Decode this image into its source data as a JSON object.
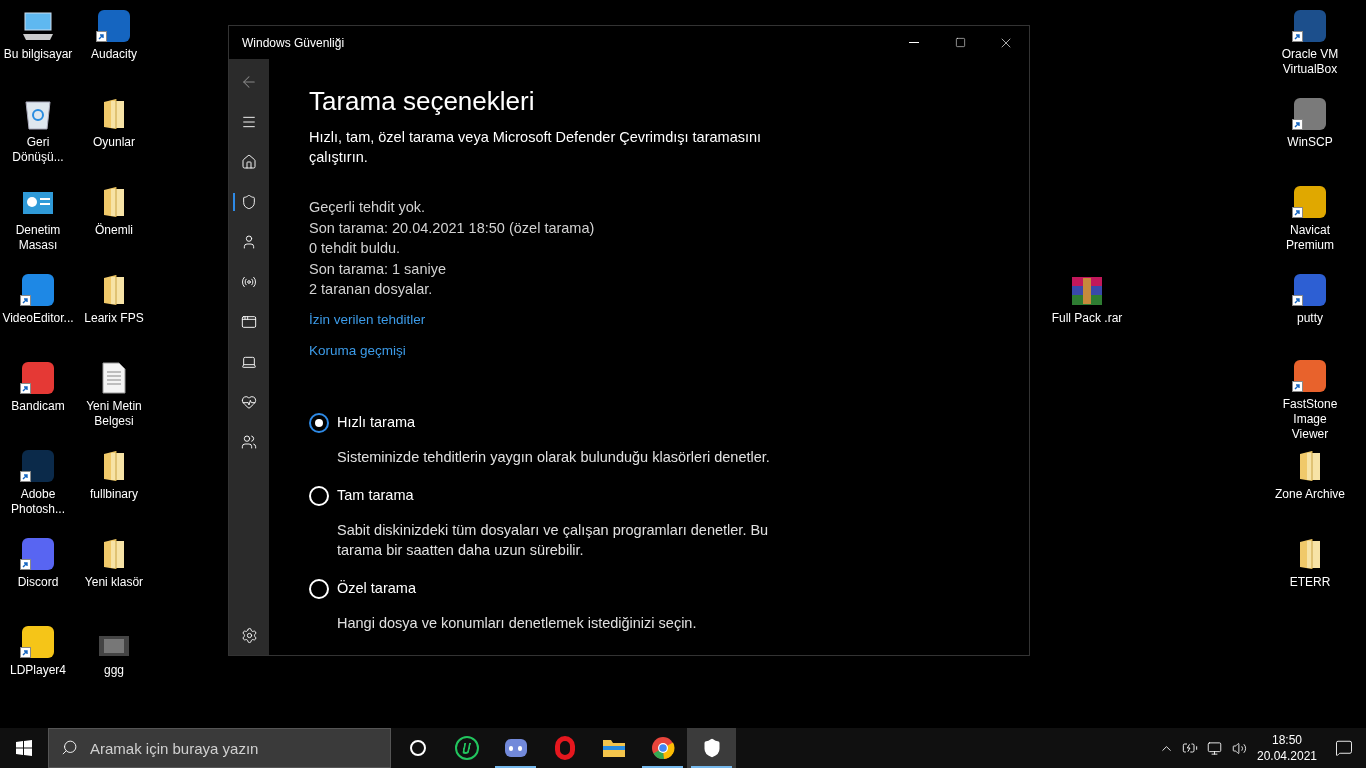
{
  "desktop": {
    "left_columns": [
      [
        {
          "label": "Bu bilgisayar",
          "kind": "computer",
          "shortcut": false
        },
        {
          "label": "Geri Dönüşü...",
          "kind": "recycle",
          "shortcut": false
        },
        {
          "label": "Denetim Masası",
          "kind": "panel",
          "shortcut": false
        },
        {
          "label": "VideoEditor...",
          "kind": "app",
          "color": "#1e88e5",
          "shortcut": true
        },
        {
          "label": "Bandicam",
          "kind": "app",
          "color": "#e53935",
          "shortcut": true
        },
        {
          "label": "Adobe Photosh...",
          "kind": "app",
          "color": "#0b2a4a",
          "shortcut": true
        },
        {
          "label": "Discord",
          "kind": "app",
          "color": "#5865f2",
          "shortcut": true
        },
        {
          "label": "LDPlayer4",
          "kind": "app",
          "color": "#f5c518",
          "shortcut": true
        }
      ],
      [
        {
          "label": "Audacity",
          "kind": "app",
          "color": "#1565c0",
          "shortcut": true
        },
        {
          "label": "Oyunlar",
          "kind": "folder",
          "shortcut": false
        },
        {
          "label": "Önemli",
          "kind": "folder",
          "shortcut": false
        },
        {
          "label": "Learix FPS",
          "kind": "folder",
          "shortcut": false
        },
        {
          "label": "Yeni Metin Belgesi",
          "kind": "document",
          "shortcut": false
        },
        {
          "label": "fullbinary",
          "kind": "folder",
          "shortcut": false
        },
        {
          "label": "Yeni klasör",
          "kind": "folder",
          "shortcut": false
        },
        {
          "label": "ggg",
          "kind": "video",
          "shortcut": false
        }
      ]
    ],
    "right_column": [
      {
        "label": "Oracle VM VirtualBox",
        "kind": "app",
        "color": "#1c4f8c",
        "shortcut": true
      },
      {
        "label": "WinSCP",
        "kind": "app",
        "color": "#7a7a7a",
        "shortcut": true
      },
      {
        "label": "Navicat Premium",
        "kind": "app",
        "color": "#e0a800",
        "shortcut": true
      },
      {
        "label": "putty",
        "kind": "app",
        "color": "#2d5fd3",
        "shortcut": true
      },
      {
        "label": "FastStone Image Viewer",
        "kind": "app",
        "color": "#e8622c",
        "shortcut": true
      },
      {
        "label": "Zone Archive",
        "kind": "folder",
        "shortcut": false
      },
      {
        "label": "ETERR",
        "kind": "folder",
        "shortcut": false
      }
    ],
    "loose_item": {
      "label": "Full Pack .rar",
      "kind": "archive",
      "shortcut": false
    }
  },
  "window": {
    "title": "Windows Güvenliği",
    "nav": [
      {
        "kind": "back",
        "selected": false
      },
      {
        "kind": "menu",
        "selected": false
      },
      {
        "kind": "home",
        "selected": false
      },
      {
        "kind": "shield",
        "selected": true
      },
      {
        "kind": "account",
        "selected": false
      },
      {
        "kind": "network",
        "selected": false
      },
      {
        "kind": "browser",
        "selected": false
      },
      {
        "kind": "device",
        "selected": false
      },
      {
        "kind": "health",
        "selected": false
      },
      {
        "kind": "family",
        "selected": false
      }
    ],
    "heading": "Tarama seçenekleri",
    "description": "Hızlı, tam, özel tarama veya Microsoft Defender Çevrimdışı taramasını çalıştırın.",
    "status_lines": [
      "Geçerli tehdit yok.",
      "Son tarama: 20.04.2021 18:50 (özel tarama)",
      "0 tehdit buldu.",
      "Son tarama: 1 saniye",
      "2 taranan dosyalar."
    ],
    "links": [
      "İzin verilen tehditler",
      "Koruma geçmişi"
    ],
    "scan_options": [
      {
        "label": "Hızlı tarama",
        "description": "Sisteminizde tehditlerin yaygın olarak bulunduğu klasörleri denetler.",
        "selected": true
      },
      {
        "label": "Tam tarama",
        "description": "Sabit diskinizdeki tüm dosyaları ve çalışan programları denetler. Bu tarama bir saatten daha uzun sürebilir.",
        "selected": false
      },
      {
        "label": "Özel tarama",
        "description": "Hangi dosya ve konumları denetlemek istediğinizi seçin.",
        "selected": false
      }
    ]
  },
  "taskbar": {
    "search": {
      "placeholder": "Aramak için buraya yazın"
    },
    "apps": [
      {
        "kind": "cortana",
        "running": false,
        "selected": false
      },
      {
        "kind": "ubar",
        "running": false,
        "selected": false
      },
      {
        "kind": "discord",
        "running": true,
        "selected": false
      },
      {
        "kind": "opera",
        "running": false,
        "selected": false
      },
      {
        "kind": "explorer",
        "running": false,
        "selected": false
      },
      {
        "kind": "chrome",
        "running": true,
        "selected": false
      },
      {
        "kind": "security",
        "running": true,
        "selected": true
      }
    ],
    "time": "18:50",
    "date": "20.04.2021"
  }
}
